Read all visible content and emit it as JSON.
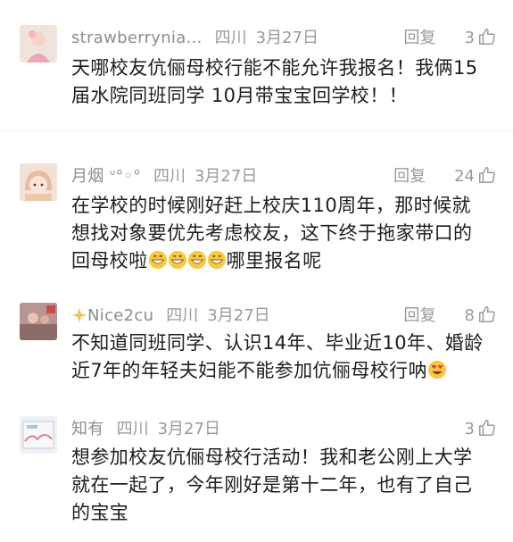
{
  "comments": [
    {
      "user": "strawberrynia...",
      "location": "四川",
      "date": "3月27日",
      "reply": "回复",
      "likes": "3",
      "text_lines": [
        "天哪校友伉俪母校行能不能允许我报名！我俩15",
        "届水院同班同学 10月带宝宝回学校！！"
      ]
    },
    {
      "user": "月烟",
      "user_deco": "ᐡ°◦°",
      "location": "四川",
      "date": "3月27日",
      "reply": "回复",
      "likes": "24",
      "text_lines": [
        "在学校的时候刚好赶上校庆110周年，那时候就",
        "想找对象要优先考虑校友，这下终于拖家带口的",
        "回母校啦",
        "哪里报名呢"
      ]
    },
    {
      "user": "Nice2cu",
      "location": "四川",
      "date": "3月27日",
      "reply": "回复",
      "likes": "8",
      "text_lines": [
        "不知道同班同学、认识14年、毕业近10年、婚龄",
        "近7年的年轻夫妇能不能参加伉俪母校行呐"
      ]
    },
    {
      "user": "知有",
      "location": "四川",
      "date": "3月27日",
      "reply": "回复",
      "likes": "3",
      "text_lines": [
        "想参加校友伉俪母校行活动！我和老公刚上大学",
        "就在一起了，今年刚好是第十二年，也有了自己",
        "的宝宝"
      ]
    }
  ]
}
